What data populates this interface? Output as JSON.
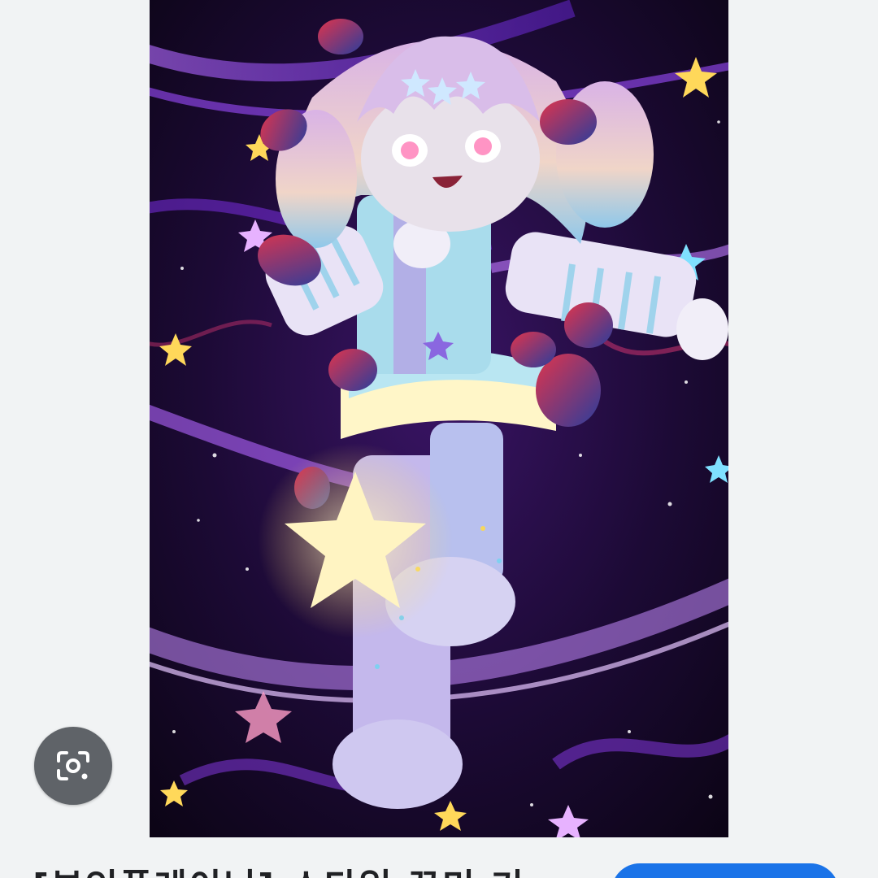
{
  "caption": {
    "title": "[부인폴레이닝] 스타일 꾸미 기"
  },
  "lens_button": {
    "icon": "google-lens-camera-icon"
  },
  "colors": {
    "page_bg": "#f1f3f4",
    "lens_bg": "#5f6368",
    "visit_button": "#1a73e8",
    "art_bg": "#12061f"
  }
}
